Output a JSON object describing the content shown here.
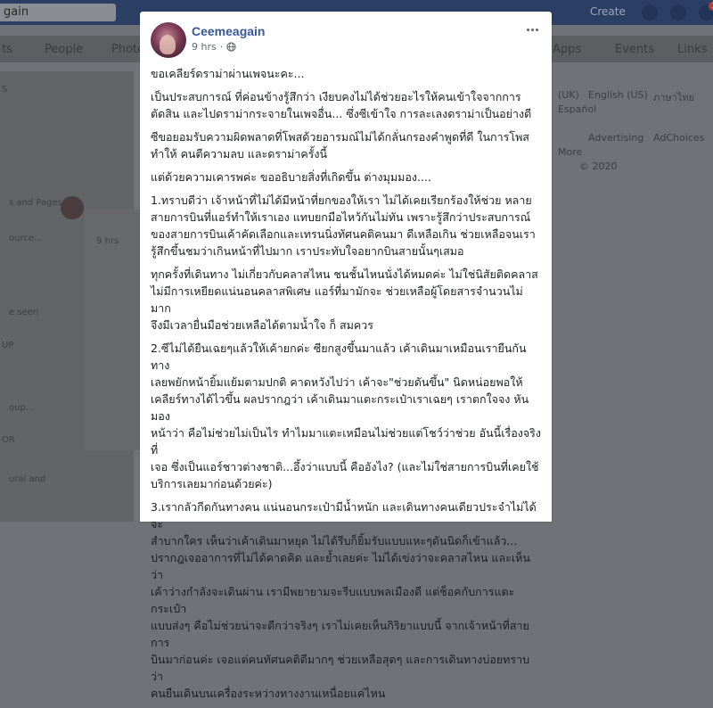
{
  "background": {
    "search_value": "gain",
    "create_label": "Create",
    "notification_count": "1",
    "nav": [
      "ts",
      "People",
      "Photo",
      "Apps",
      "Events",
      "Links"
    ],
    "left_labels": [
      "S",
      "s and Pages",
      "ource...",
      "9 hrs",
      "e seen",
      "UP",
      "oup...",
      "OR",
      "ural and"
    ],
    "right_links": [
      "(UK)",
      "English (US)",
      "ภาษาไทย",
      "Español",
      "Advertising",
      "AdChoices",
      "More",
      "© 2020"
    ]
  },
  "post": {
    "author": "Ceemeagain",
    "time": "9 hrs",
    "audience_icon": "globe-icon",
    "paragraphs": [
      "ขอเคลียร์ดราม่าผ่านเพจนะคะ...",
      "เป็นประสบการณ์ ที่ค่อนข้างรู้สึกว่า เงียบคงไม่ได้ช่วยอะไรให้คนเข้าใจจากการ\nตัดสิน และไปดราม่ากระจายในเพจอื่น... ซึ่งซีเข้าใจ การละเลงดราม่าเป็นอย่างดี",
      "ซีขอยอมรับความผิดพลาดที่โพสด้วยอารมณ์ไม่ได้กลั่นกรองคำพูดที่ดี ในการโพส\nทำให้ คนตีความลบ และดราม่าครั้งนี้",
      "แต่ด้วยความเคารพค่ะ ขออธิบายสิ่งที่เกิดขึ้น ต่างมุมมอง....",
      "1.ทราบดีว่า เจ้าหน้าที่ไม่ได้มีหน้าที่ยกของให้เรา ไม่ได้เคยเรียกร้องให้ช่วย หลาย\nสายการบินที่แอร์ทำให้เราเอง แทบยกมือไหว้กันไม่ทัน เพราะรู้สึกว่าประสบการณ์\nของสายการบินเค้าคัดเลือกและเทรนนิ่งทัศนคติคนมา ดีเหลือเกิน ช่วยเหลือจนเรา\nรู้สึกขึ้นชมว่าเกินหน้าที่ไปมาก เราประทับใจอยากบินสายนั้นๆเสมอ",
      "ทุกครั้งที่เดินทาง ไม่เกี่ยวกับคลาสไหน ชนชั้นไหนนั่งได้หมดค่ะ ไม่ใช่นิสัยติดคลาส\nไม่มีการเหยียดแน่นอนคลาสพิเศษ แอร์ที่มามักจะ ช่วยเหลือผู้โดยสารจำนวนไม่มาก\nจึงมีเวลายื่นมือช่วยเหลือได้ตามน้ำใจ ก็ สมควร",
      "2.ซีไม่ได้ยืนเฉยๆแล้วให้เค้ายกค่ะ ซียกสูงขึ้นมาแล้ว เค้าเดินมาเหมือนเรายืนกันทาง\nเลยพยักหน้ายิ้มแย้มตามปกติ คาดหวังไปว่า เค้าจะ\"ช่วยดันขึ้น\" นิดหน่อยพอให้\nเคลียร์ทางได้ไวขึ้น ผลปรากฎว่า เค้าเดินมาแตะกระเป๋าเราเฉยๆ เราตกใจจง หันมอง\nหน้าว่า คือไม่ช่วยไม่เป็นไร ทำไมมาแตะเหมือนไม่ช่วยแต่โชว์ว่าช่วย อันนี้เรื่องจริงที่\nเจอ ซึ่งเป็นแอร์ชาวต่างชาติ...อึ้งว่าแบบนี้ คืออังไง? (และไม่ใช่สายการบินที่เคยใช้\nบริการเลยมาก่อนด้วยค่ะ)",
      "3.เรากลัวกีดกันทางคน แน่นอนกระเป๋ามีน้ำหนัก และเดินทางคนเดียวประจำไม่ได้จะ\nสำบากใคร เห็นว่าเค้าเดินมาหยุด ไม่ได้รีบก็ยิ้มรับแบบแหะๆดันนิดก็เข้าแล้ว...\nปรากฎเจออาการที่ไม่ได้คาดคิด และย้ำเลยค่ะ ไม่ได้เข่งว่าจะคลาสไหน และเห็นว่า\nเค้าว่างกำลังจะเดินผ่าน เรามีพยายามจะรีบแบบพลเมืองดี แต่ช็อคกับการแตะกระเป๋า\nแบบส่งๆ คือไม่ช่วยน่าจะดีกว่าจริงๆ เราไม่เคยเห็นกิริยาแบบนี้ จากเจ้าหน้าที่สายการ\nบินมาก่อนค่ะ เจอแต่คนทัศนคติดีมากๆ ช่วยเหลือสุดๆ และการเดินทางบ่อยทราบว่า\nคนยืนเดินบนเครื่องระหว่างทางงานเหนื่อยแค่ไหน"
    ]
  }
}
